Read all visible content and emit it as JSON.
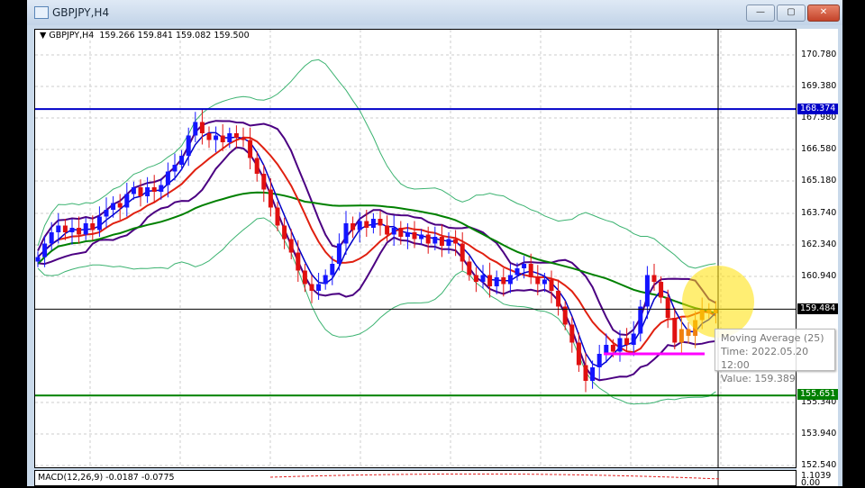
{
  "window": {
    "title": "GBPJPY,H4",
    "minimize": "—",
    "maximize": "▢",
    "close": "✕"
  },
  "chart_header": {
    "symbol": "GBPJPY,H4",
    "open": "159.266",
    "high": "159.841",
    "low": "159.082",
    "close": "159.500"
  },
  "axis_ticks": [
    "170.780",
    "169.380",
    "167.980",
    "166.580",
    "165.180",
    "163.740",
    "162.340",
    "160.940",
    "155.340",
    "153.940",
    "152.540"
  ],
  "price_tags": {
    "resistance": {
      "value": "168.374",
      "color": "#0000c8"
    },
    "current": {
      "value": "159.484",
      "color": "#000000"
    },
    "support": {
      "value": "155.651",
      "color": "#008000"
    }
  },
  "tooltip": {
    "line1": "Moving Average (25)",
    "line2": "Time: 2022.05.20 12:00",
    "line3": "Value: 159.389"
  },
  "macd": {
    "label": "MACD(12,26,9) -0.0187 -0.0775",
    "axis_top": "1.1039",
    "axis_zero": "0.00"
  },
  "chart_data": {
    "type": "candlestick",
    "ylim": [
      152.0,
      171.8
    ],
    "closes": [
      161.8,
      162.4,
      162.9,
      163.2,
      162.9,
      163.1,
      162.8,
      163.3,
      163.0,
      163.6,
      163.9,
      164.2,
      164.0,
      164.6,
      164.9,
      164.5,
      164.9,
      164.7,
      165.0,
      165.6,
      165.9,
      166.3,
      167.2,
      167.8,
      167.3,
      167.0,
      167.2,
      166.9,
      167.3,
      167.1,
      167.0,
      166.2,
      165.5,
      164.8,
      164.0,
      163.2,
      162.6,
      162.0,
      161.2,
      160.6,
      160.3,
      160.6,
      161.0,
      161.5,
      162.4,
      163.3,
      163.0,
      163.4,
      163.1,
      163.5,
      163.2,
      162.8,
      163.1,
      162.7,
      162.9,
      162.6,
      162.8,
      162.4,
      162.7,
      162.3,
      162.6,
      162.4,
      161.6,
      161.0,
      160.7,
      161.0,
      160.5,
      160.9,
      160.6,
      161.0,
      161.3,
      161.5,
      160.9,
      160.6,
      160.8,
      160.3,
      159.6,
      158.8,
      158.0,
      157.0,
      156.3,
      156.9,
      157.5,
      157.9,
      157.6,
      158.2,
      157.9,
      158.4,
      159.6,
      161.0,
      160.7,
      160.0,
      159.1,
      158.0,
      158.6,
      158.3,
      159.0,
      159.5,
      159.3,
      159.5
    ],
    "horizontal_lines": [
      168.374,
      159.484,
      155.651
    ],
    "magenta_level": 157.5,
    "colors": {
      "bull": "#1414ff",
      "bear": "#e01010",
      "ma_fast": "#0000c8",
      "ma_mid": "#e02010",
      "ma_slow": "#008000",
      "band_inner": "#4b0082",
      "band_outer": "#3cb371",
      "highlight": "#ffe000"
    }
  }
}
